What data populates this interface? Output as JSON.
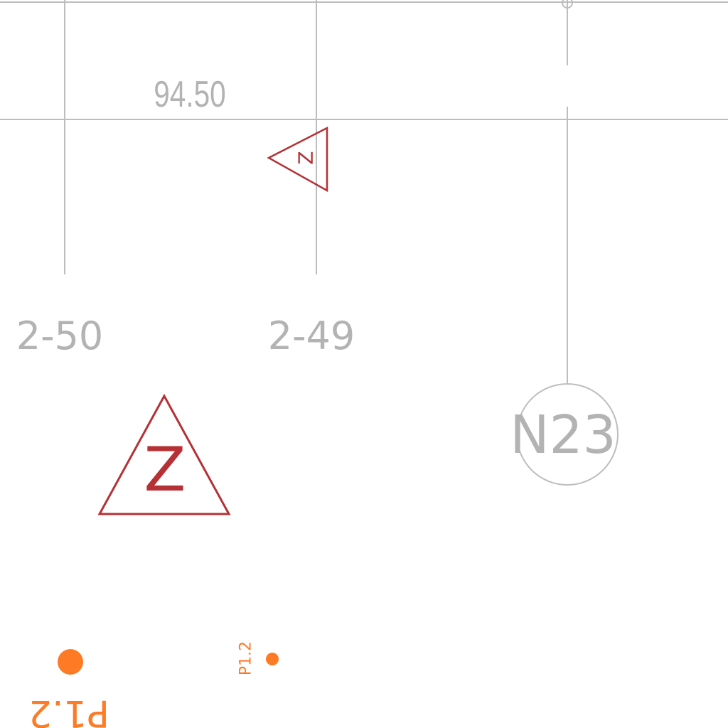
{
  "colors": {
    "background": "#ffffff",
    "grid_line": "#bdbdbd",
    "label_gray": "#b3b3b3",
    "marker_red": "#b53135",
    "point_orange": "#ff7a25"
  },
  "dimension": {
    "value": "94.50"
  },
  "grid_labels": {
    "left": "2-50",
    "right": "2-49"
  },
  "node": {
    "label": "N23"
  },
  "markers": {
    "small_triangle_letter": "Z",
    "large_triangle_letter": "Z"
  },
  "points": {
    "left_label": "P1.2",
    "right_label": "P1.2"
  },
  "icons": {
    "triangle": "triangle-marker-icon",
    "circle": "node-circle-icon",
    "point": "point-dot-icon"
  }
}
